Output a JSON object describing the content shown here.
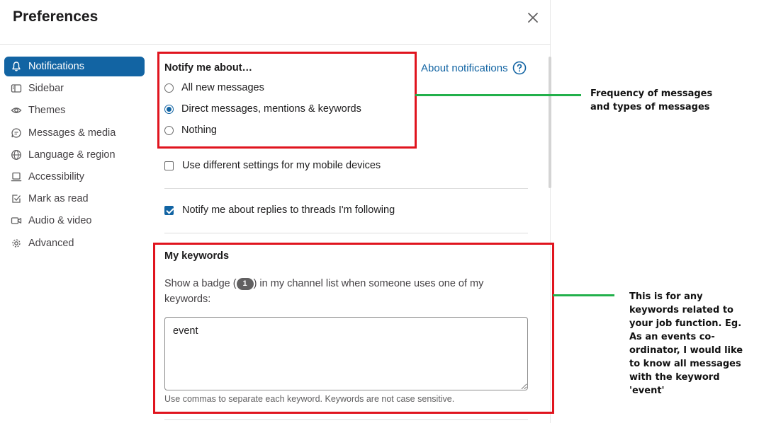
{
  "modal": {
    "title": "Preferences",
    "close_icon": "close-icon"
  },
  "sidebar": {
    "items": [
      {
        "label": "Notifications",
        "icon": "bell-icon",
        "active": true
      },
      {
        "label": "Sidebar",
        "icon": "sidebar-panel-icon"
      },
      {
        "label": "Themes",
        "icon": "eye-icon"
      },
      {
        "label": "Messages & media",
        "icon": "message-bubble-icon"
      },
      {
        "label": "Language & region",
        "icon": "globe-icon"
      },
      {
        "label": "Accessibility",
        "icon": "laptop-icon"
      },
      {
        "label": "Mark as read",
        "icon": "check-square-icon"
      },
      {
        "label": "Audio & video",
        "icon": "video-camera-icon"
      },
      {
        "label": "Advanced",
        "icon": "gear-icon"
      }
    ]
  },
  "notify": {
    "title": "Notify me about…",
    "about_link": "About notifications",
    "options": [
      {
        "label": "All new messages",
        "checked": false
      },
      {
        "label": "Direct messages, mentions & keywords",
        "checked": true
      },
      {
        "label": "Nothing",
        "checked": false
      }
    ],
    "mobile_label": "Use different settings for my mobile devices",
    "mobile_checked": false,
    "threads_label": "Notify me about replies to threads I'm following",
    "threads_checked": true
  },
  "keywords": {
    "title": "My keywords",
    "desc_before": "Show a badge (",
    "badge": "1",
    "desc_after": ") in my channel list when someone uses one of my keywords:",
    "value": "event",
    "hint": "Use commas to separate each keyword. Keywords are not case sensitive."
  },
  "annotations": {
    "note1": [
      "Frequency of messages",
      "and types of messages"
    ],
    "note2": [
      "This is for any",
      "keywords related to",
      "your job function.  Eg.",
      "As an events co-",
      "ordinator, I would like",
      "to know all messages",
      "with the keyword",
      "'event'"
    ],
    "box_color": "#e0141e",
    "line_color": "#22b04b"
  },
  "colors": {
    "accent": "#1264a3",
    "text": "#1d1c1d"
  }
}
